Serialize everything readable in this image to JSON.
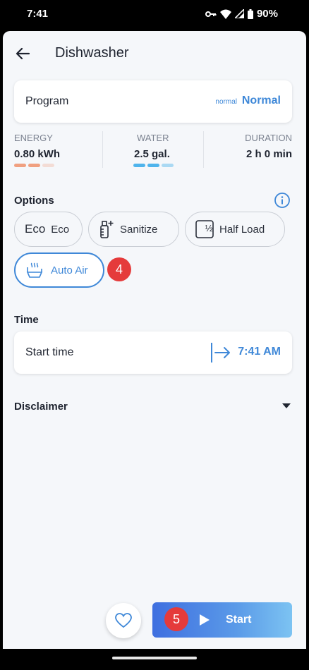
{
  "status_bar": {
    "time": "7:41",
    "battery": "90%"
  },
  "header": {
    "title": "Dishwasher"
  },
  "program": {
    "label": "Program",
    "small_value": "normal",
    "value": "Normal"
  },
  "stats": [
    {
      "label": "ENERGY",
      "value": "0.80 kWh",
      "level": 2,
      "color": "#f0a080"
    },
    {
      "label": "WATER",
      "value": "2.5 gal.",
      "level": 2.5,
      "color": "#4fb4ec"
    },
    {
      "label": "DURATION",
      "value": "2 h 0 min"
    }
  ],
  "options": {
    "title": "Options",
    "items": [
      {
        "glyph": "Eco",
        "label": "Eco",
        "selected": false
      },
      {
        "label": "Sanitize",
        "selected": false
      },
      {
        "glyph": "½",
        "label": "Half Load",
        "selected": false
      },
      {
        "label": "Auto Air",
        "selected": true
      }
    ]
  },
  "time": {
    "title": "Time",
    "label": "Start time",
    "value": "7:41 AM"
  },
  "disclaimer": {
    "label": "Disclaimer"
  },
  "actions": {
    "start_label": "Start"
  },
  "annotations": {
    "badge_4": "4",
    "badge_5": "5"
  },
  "colors": {
    "accent": "#3f88d8",
    "badge": "#e53b3b",
    "background": "#f5f7fa"
  }
}
